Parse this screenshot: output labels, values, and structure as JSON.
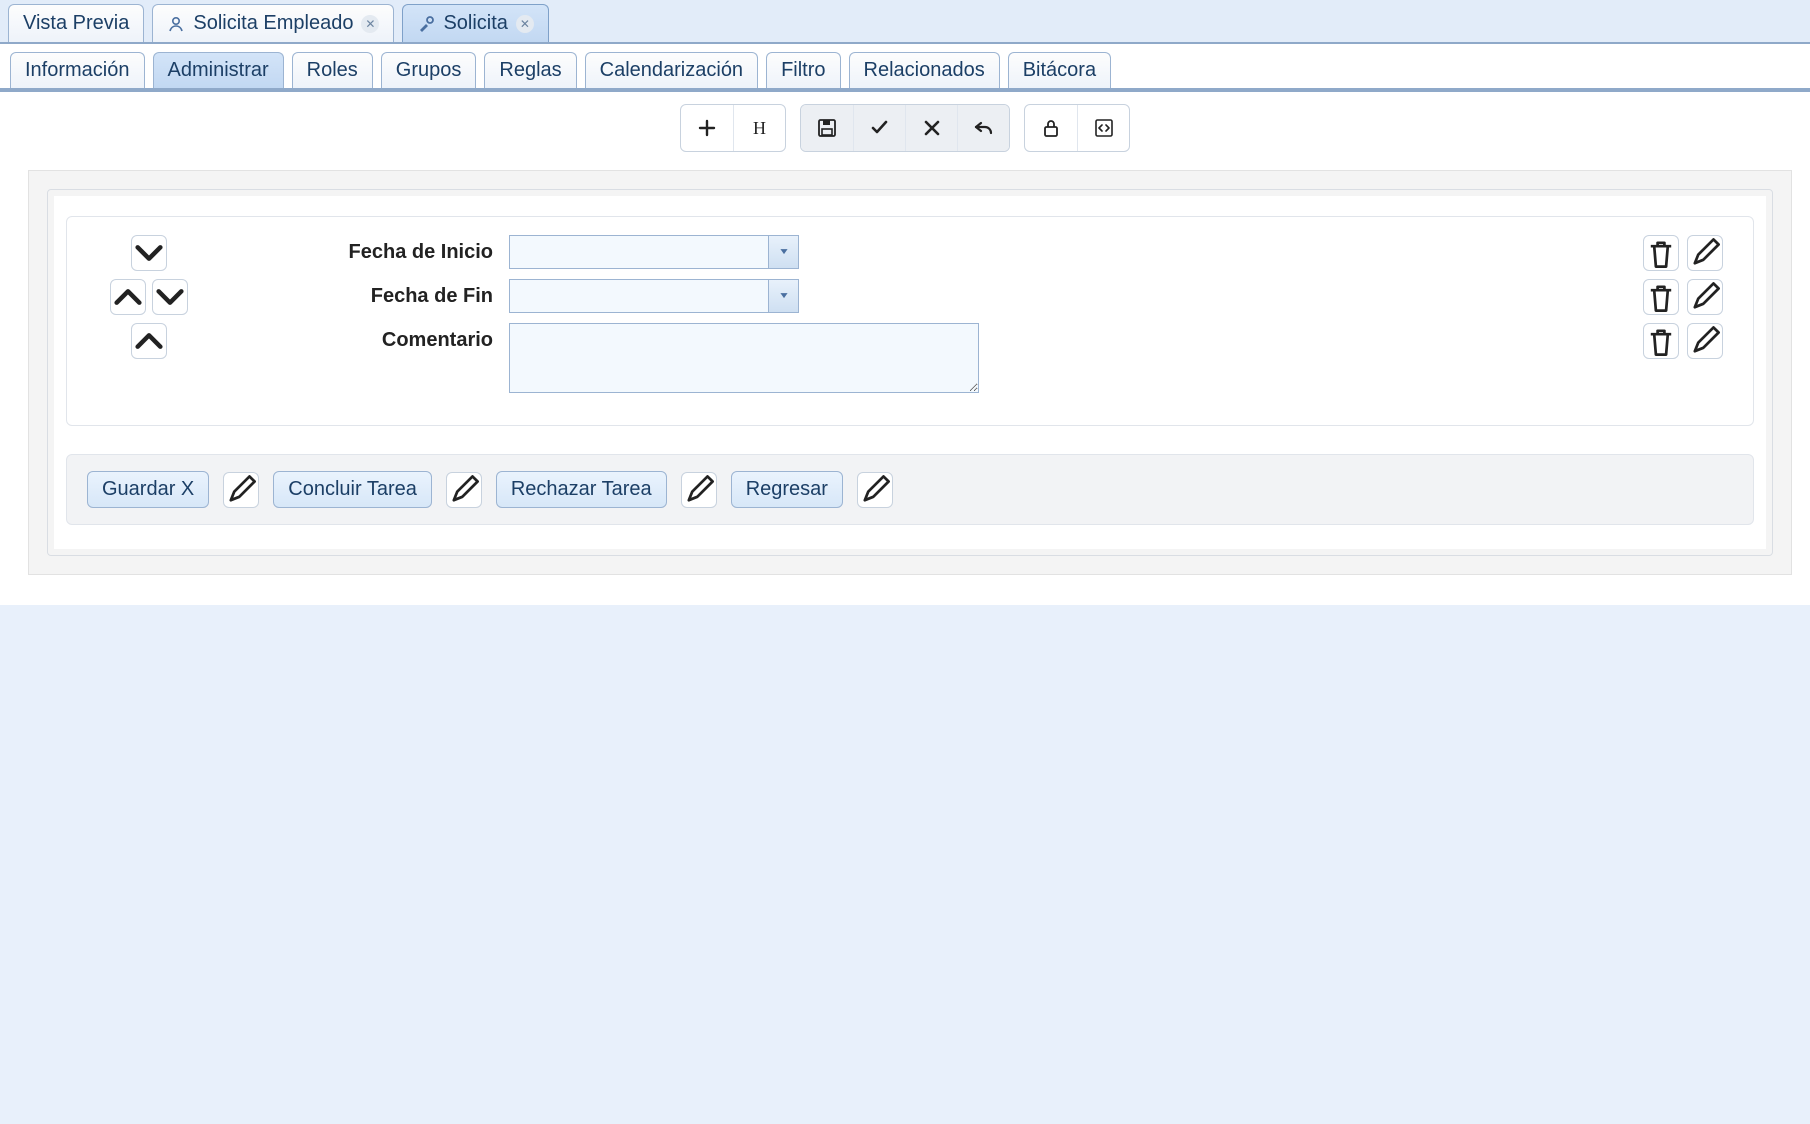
{
  "docTabs": [
    {
      "label": "Vista Previa",
      "icon": null,
      "closable": false,
      "active": false
    },
    {
      "label": "Solicita Empleado",
      "icon": "person",
      "closable": true,
      "active": false
    },
    {
      "label": "Solicita",
      "icon": "tools",
      "closable": true,
      "active": true
    }
  ],
  "subTabs": {
    "items": [
      "Información",
      "Administrar",
      "Roles",
      "Grupos",
      "Reglas",
      "Calendarización",
      "Filtro",
      "Relacionados",
      "Bitácora"
    ],
    "activeIndex": 1
  },
  "toolbar": {
    "group1": [
      "plus",
      "header-h"
    ],
    "group2": [
      "save",
      "check",
      "close-x",
      "undo"
    ],
    "group3": [
      "lock",
      "code"
    ]
  },
  "form": {
    "rows": [
      {
        "label": "Fecha de Inicio",
        "type": "combo",
        "value": "",
        "reorder": [
          "down"
        ]
      },
      {
        "label": "Fecha de Fin",
        "type": "combo",
        "value": "",
        "reorder": [
          "up",
          "down"
        ]
      },
      {
        "label": "Comentario",
        "type": "textarea",
        "value": "",
        "reorder": [
          "up"
        ]
      }
    ]
  },
  "actions": {
    "buttons": [
      "Guardar X",
      "Concluir Tarea",
      "Rechazar Tarea",
      "Regresar"
    ]
  }
}
